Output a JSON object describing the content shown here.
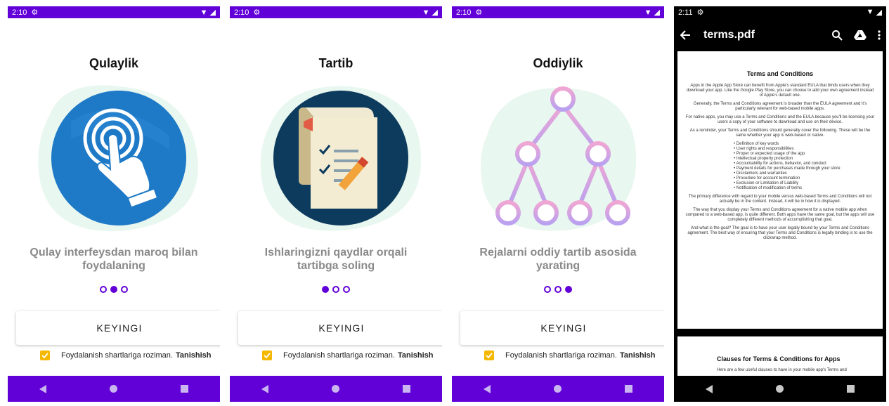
{
  "screens": [
    {
      "time": "2:10",
      "title": "Qulaylik",
      "description": "Qulay interfeysdan maroq bilan foydalaning",
      "active_dot": 1,
      "button": "KEYINGI",
      "terms_text": "Foydalanish shartlariga roziman.",
      "terms_link": "Tanishish",
      "illustration": "touch-hand-icon"
    },
    {
      "time": "2:10",
      "title": "Tartib",
      "description": "Ishlaringizni qaydlar orqali tartibga soling",
      "active_dot": 0,
      "button": "KEYINGI",
      "terms_text": "Foydalanish shartlariga roziman.",
      "terms_link": "Tanishish",
      "illustration": "checklist-scroll-icon"
    },
    {
      "time": "2:10",
      "title": "Oddiylik",
      "description": "Rejalarni oddiy tartib asosida yarating",
      "active_dot": 2,
      "button": "KEYINGI",
      "terms_text": "Foydalanish shartlariga roziman.",
      "terms_link": "Tanishish",
      "illustration": "tree-diagram-icon"
    }
  ],
  "pdf": {
    "time": "2:11",
    "title": "terms.pdf",
    "page1_title": "Terms and Conditions",
    "p1": "Apps in the Apple App Store can benefit from Apple's standard EULA that binds users when they download your app. Like the Google Play Store, you can choose to add your own agreement instead of Apple's default one.",
    "p2": "Generally, the Terms and Conditions agreement is broader than the EULA agreement and it's particularly relevant for web-based mobile apps.",
    "p3": "For native apps, you may use a Terms and Conditions and the EULA because you'll be licensing your users a copy of your software to download and use on their device.",
    "p4": "As a reminder, your Terms and Conditions should generally cover the following. These will be the same whether your app is web-based or native.",
    "list": [
      "Definition of key words",
      "User rights and responsibilities",
      "Proper or expected usage of the app",
      "Intellectual property protection",
      "Accountability for actions, behavior, and conduct",
      "Payment details for purchases made through your store",
      "Disclaimers and warranties",
      "Procedure for account termination",
      "Exclusion or Limitation of Liability",
      "Notification of modification of terms"
    ],
    "p5": "The primary difference with regard to your mobile versus web-based Terms and Conditions will not actually be in the content. Instead, it will be in how it is displayed.",
    "p6": "The way that you display your Terms and Conditions agreement for a native mobile app when compared to a web-based app, is quite different. Both apps have the same goal, but the apps will use completely different methods of accomplishing that goal.",
    "p7": "And what is the goal? The goal is to have your user legally bound by your Terms and Conditions agreement. The best way of ensuring that your Terms and Conditions is legally binding is to use the clickwrap method.",
    "page2_title": "Clauses for Terms & Conditions for Apps",
    "page2_text": "Here are a few useful clauses to have in your mobile app's Terms and"
  },
  "colors": {
    "primary": "#6200d8",
    "checkbox": "#f5b800"
  }
}
